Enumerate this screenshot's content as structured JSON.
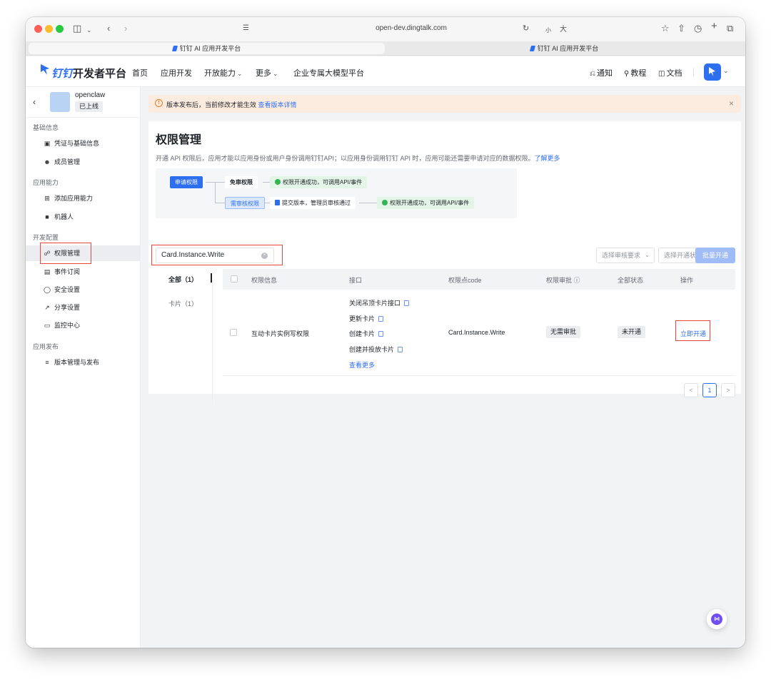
{
  "browser": {
    "url": "open-dev.dingtalk.com",
    "font_small": "小",
    "font_large": "大",
    "tabs": [
      {
        "label": "钉钉 AI 应用开发平台",
        "active": true
      },
      {
        "label": "钉钉 AI 应用开发平台",
        "active": false
      }
    ]
  },
  "header": {
    "brand_dd": "钉钉",
    "brand_rest": "开发者平台",
    "nav": [
      "首页",
      "应用开发",
      "开放能力",
      "更多",
      "企业专属大模型平台"
    ],
    "right": {
      "notify": "通知",
      "tutorial": "教程",
      "docs": "文档"
    }
  },
  "sidebar": {
    "app_name": "openclaw",
    "app_status": "已上线",
    "groups": [
      {
        "title": "基础信息",
        "items": [
          "凭证与基础信息",
          "成员管理"
        ]
      },
      {
        "title": "应用能力",
        "items": [
          "添加应用能力",
          "机器人"
        ]
      },
      {
        "title": "开发配置",
        "items": [
          "权限管理",
          "事件订阅",
          "安全设置",
          "分享设置",
          "监控中心"
        ]
      },
      {
        "title": "应用发布",
        "items": [
          "版本管理与发布"
        ]
      }
    ],
    "active_item": "权限管理"
  },
  "banner": {
    "text": "版本发布后，当前修改才能生效",
    "link": "查看版本详情"
  },
  "page": {
    "title": "权限管理",
    "description": "开通 API 权限后，应用才能以应用身份或用户身份调用钉钉API；以应用身份调用钉钉 API 时，应用可能还需要申请对应的数据权限。",
    "learn_more": "了解更多"
  },
  "flow": {
    "apply": "申请权限",
    "free": "免审权限",
    "free_result": "权限开通成功，可调用API/事件",
    "need_review": "需审核权限",
    "submit": "提交版本，管理员审核通过",
    "review_result": "权限开通成功，可调用API/事件"
  },
  "filters": {
    "search_value": "Card.Instance.Write",
    "review_placeholder": "选择审核要求",
    "status_placeholder": "选择开通状态",
    "batch_button": "批量开通"
  },
  "tabs": [
    {
      "label": "全部（1）",
      "active": true
    },
    {
      "label": "卡片（1）",
      "active": false
    }
  ],
  "table": {
    "headers": [
      "权限信息",
      "接口",
      "权限点code",
      "权限审批",
      "全部状态",
      "操作"
    ],
    "rows": [
      {
        "name": "互动卡片实例写权限",
        "apis": [
          "关闭吊顶卡片接口",
          "更新卡片",
          "创建卡片",
          "创建并投放卡片"
        ],
        "more": "查看更多",
        "code": "Card.Instance.Write",
        "approval": "无需审批",
        "status": "未开通",
        "action": "立即开通"
      }
    ]
  },
  "pagination": {
    "prev": "<",
    "current": "1",
    "next": ">"
  },
  "colors": {
    "accent": "#2e6ff0",
    "highlight_box": "#e8453c",
    "banner_bg": "#fcecdf"
  }
}
